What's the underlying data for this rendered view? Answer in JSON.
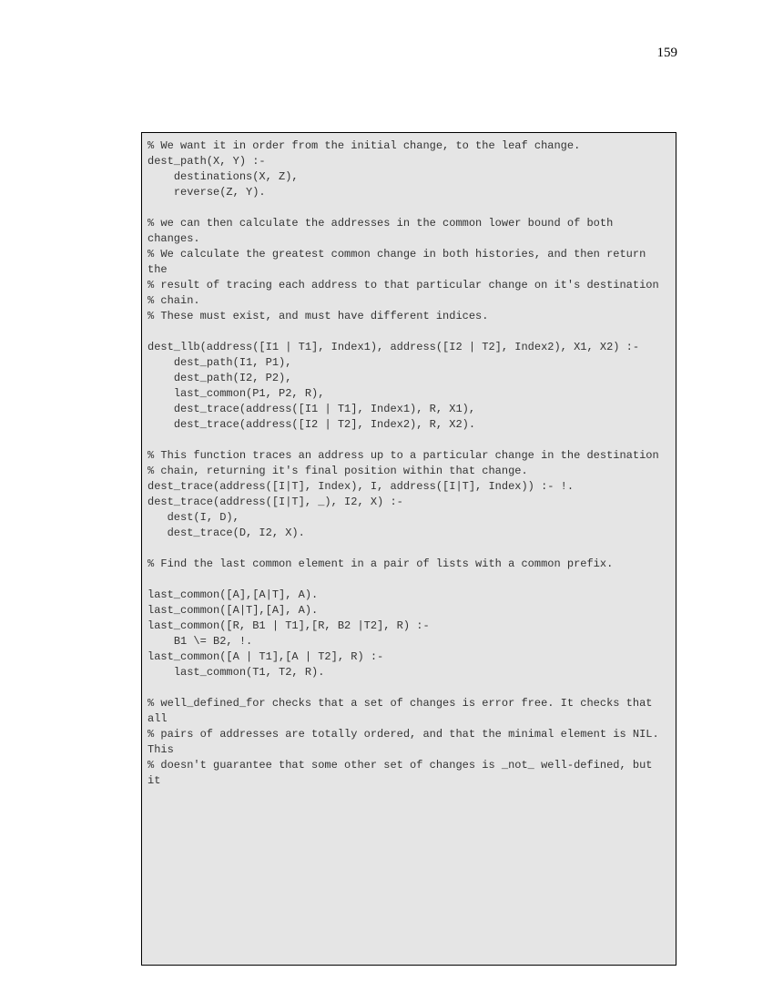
{
  "page_number": "159",
  "code": "% We want it in order from the initial change, to the leaf change.\ndest_path(X, Y) :-\n    destinations(X, Z),\n    reverse(Z, Y).\n\n% we can then calculate the addresses in the common lower bound of both changes.\n% We calculate the greatest common change in both histories, and then return the\n% result of tracing each address to that particular change on it's destination\n% chain.\n% These must exist, and must have different indices.\n\ndest_llb(address([I1 | T1], Index1), address([I2 | T2], Index2), X1, X2) :-\n    dest_path(I1, P1),\n    dest_path(I2, P2),\n    last_common(P1, P2, R),\n    dest_trace(address([I1 | T1], Index1), R, X1),\n    dest_trace(address([I2 | T2], Index2), R, X2).\n\n% This function traces an address up to a particular change in the destination\n% chain, returning it's final position within that change.\ndest_trace(address([I|T], Index), I, address([I|T], Index)) :- !.\ndest_trace(address([I|T], _), I2, X) :-\n   dest(I, D),\n   dest_trace(D, I2, X).\n\n% Find the last common element in a pair of lists with a common prefix.\n\nlast_common([A],[A|T], A).\nlast_common([A|T],[A], A).\nlast_common([R, B1 | T1],[R, B2 |T2], R) :-\n    B1 \\= B2, !.\nlast_common([A | T1],[A | T2], R) :-\n    last_common(T1, T2, R).\n\n% well_defined_for checks that a set of changes is error free. It checks that all\n% pairs of addresses are totally ordered, and that the minimal element is NIL. This\n% doesn't guarantee that some other set of changes is _not_ well-defined, but it"
}
